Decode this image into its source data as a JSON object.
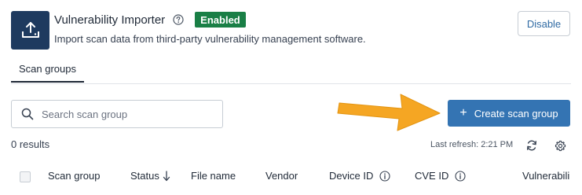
{
  "header": {
    "title": "Vulnerability Importer",
    "status_badge": "Enabled",
    "description": "Import scan data from third-party vulnerability management software.",
    "disable_label": "Disable",
    "app_icon": "upload-tray-icon"
  },
  "tabs": [
    {
      "label": "Scan groups",
      "active": true
    }
  ],
  "search": {
    "placeholder": "Search scan group",
    "value": ""
  },
  "actions": {
    "create_label": "Create scan group"
  },
  "results": {
    "count_label": "0 results",
    "last_refresh": "Last refresh: 2:21 PM"
  },
  "table": {
    "columns": [
      {
        "label": "Scan group"
      },
      {
        "label": "Status",
        "sort": "descending"
      },
      {
        "label": "File name"
      },
      {
        "label": "Vendor"
      },
      {
        "label": "Device ID",
        "info": true
      },
      {
        "label": "CVE ID",
        "info": true
      },
      {
        "label": "Vulnerabili"
      }
    ]
  },
  "colors": {
    "brand_dark": "#1e3a5f",
    "primary": "#3474b3",
    "enabled": "#1a7f46",
    "arrow": "#f5a623"
  }
}
